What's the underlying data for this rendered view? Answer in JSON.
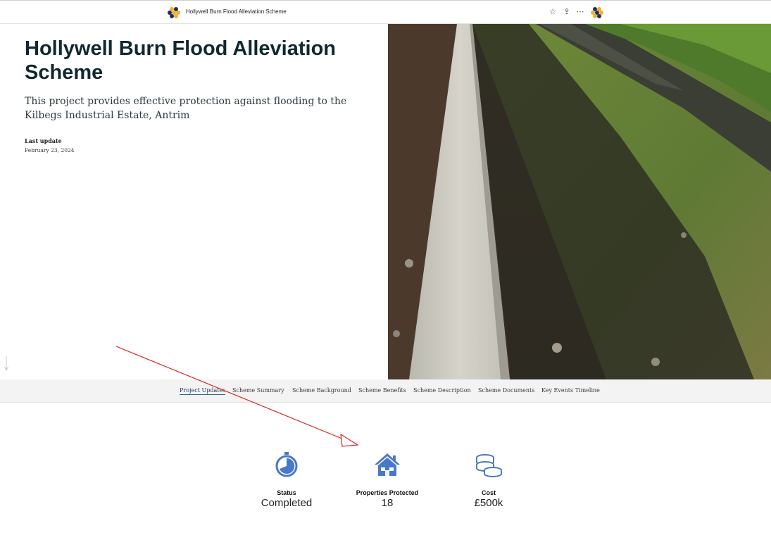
{
  "header": {
    "site_title": "Hollywell Burn Flood Alleviation Scheme",
    "icons": [
      "honeycomb-logo-icon",
      "star-icon",
      "share-icon",
      "more-icon",
      "user-avatar-icon"
    ]
  },
  "hero": {
    "title": "Hollywell Burn Flood Alleviation Scheme",
    "subtitle": "This project provides effective protection against flooding to the Kilbegs Industrial Estate, Antrim",
    "last_update_label": "Last update",
    "last_update_date": "February 23, 2024"
  },
  "nav": {
    "items": [
      {
        "label": "Project Updates",
        "active": true
      },
      {
        "label": "Scheme Summary",
        "active": false
      },
      {
        "label": "Scheme Background",
        "active": false
      },
      {
        "label": "Scheme Benefits",
        "active": false
      },
      {
        "label": "Scheme Description",
        "active": false
      },
      {
        "label": "Scheme Documents",
        "active": false
      },
      {
        "label": "Key Events Timeline",
        "active": false
      }
    ]
  },
  "stats": [
    {
      "label": "Status",
      "value": "Completed",
      "icon": "stopwatch-icon"
    },
    {
      "label": "Properties Protected",
      "value": "18",
      "icon": "house-icon"
    },
    {
      "label": "Cost",
      "value": "£500k",
      "icon": "coins-icon"
    }
  ],
  "colors": {
    "title": "#10282e",
    "icon_blue": "#4a78c8",
    "logo_navy": "#1d2f5e",
    "logo_gold": "#f2b02a",
    "annotation_red": "#e0201c"
  }
}
